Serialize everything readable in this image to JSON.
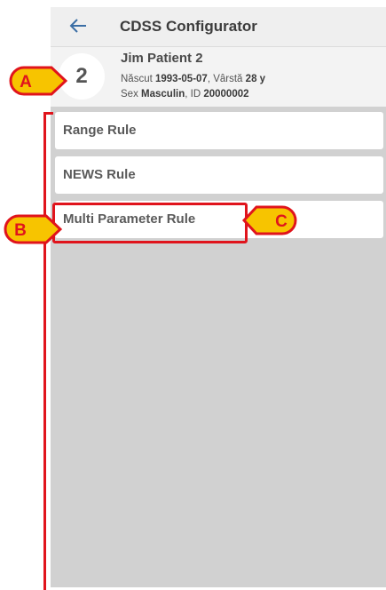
{
  "header": {
    "title": "CDSS Configurator",
    "back_icon": "arrow-left-icon"
  },
  "patient": {
    "bed": "2",
    "name": "Jim Patient 2",
    "birth_label": "Născut",
    "birth_date": "1993-05-07",
    "age_label": "Vârstă",
    "age": "28 y",
    "sex_label": "Sex",
    "sex": "Masculin",
    "id_label": "ID",
    "id": "20000002"
  },
  "rules": [
    {
      "label": "Range Rule"
    },
    {
      "label": "NEWS Rule"
    },
    {
      "label": "Multi Parameter Rule"
    }
  ],
  "callouts": {
    "a": "A",
    "b": "B",
    "c": "C"
  },
  "colors": {
    "callout_fill": "#f7c400",
    "callout_outline": "#e0141c",
    "list_bg": "#d1d1d1",
    "header_bg": "#efefef"
  }
}
